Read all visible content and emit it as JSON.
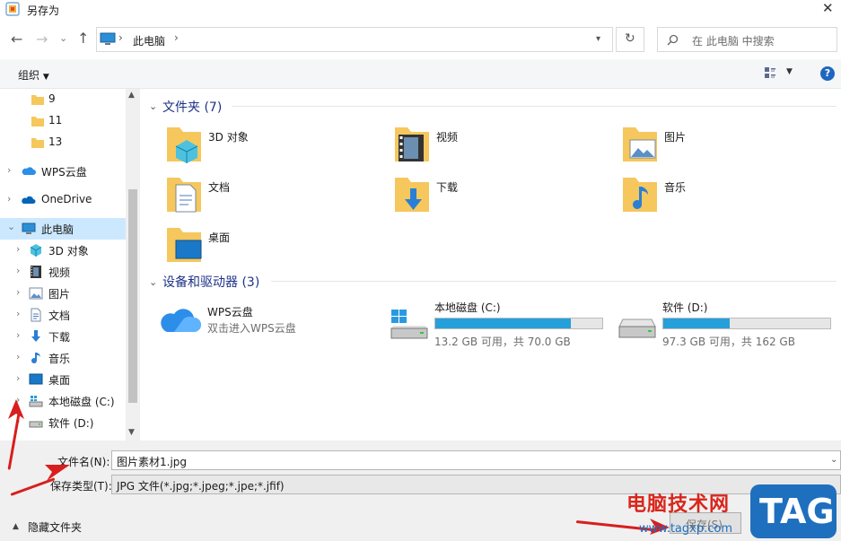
{
  "window": {
    "title": "另存为",
    "close_glyph": "✕"
  },
  "nav": {
    "back_glyph": "←",
    "forward_glyph": "→",
    "recent_glyph": "⌄",
    "up_glyph": "↑",
    "address_label": "此电脑",
    "sep_glyph": "›",
    "refresh_glyph": "↻",
    "search_placeholder": "在 此电脑 中搜索"
  },
  "toolbar": {
    "organize_label": "组织",
    "help_glyph": "?"
  },
  "sidebar": {
    "items": [
      {
        "label": "9"
      },
      {
        "label": "11"
      },
      {
        "label": "13"
      },
      {
        "label": "WPS云盘"
      },
      {
        "label": "OneDrive"
      },
      {
        "label": "此电脑"
      },
      {
        "label": "3D 对象"
      },
      {
        "label": "视频"
      },
      {
        "label": "图片"
      },
      {
        "label": "文档"
      },
      {
        "label": "下载"
      },
      {
        "label": "音乐"
      },
      {
        "label": "桌面"
      },
      {
        "label": "本地磁盘 (C:)"
      },
      {
        "label": "软件 (D:)"
      }
    ]
  },
  "main": {
    "folders_title": "文件夹 (7)",
    "folders": [
      {
        "label": "3D 对象"
      },
      {
        "label": "视频"
      },
      {
        "label": "图片"
      },
      {
        "label": "文档"
      },
      {
        "label": "下载"
      },
      {
        "label": "音乐"
      },
      {
        "label": "桌面"
      }
    ],
    "devices_title": "设备和驱动器 (3)",
    "wps": {
      "name": "WPS云盘",
      "desc": "双击进入WPS云盘"
    },
    "drives": [
      {
        "name": "本地磁盘 (C:)",
        "free": "13.2 GB 可用，共 70.0 GB",
        "used_fraction": 0.81
      },
      {
        "name": "软件 (D:)",
        "free": "97.3 GB 可用，共 162 GB",
        "used_fraction": 0.4
      }
    ]
  },
  "form": {
    "filename_label": "文件名(N):",
    "filename_value": "图片素材1.jpg",
    "filetype_label": "保存类型(T):",
    "filetype_value": "JPG 文件(*.jpg;*.jpeg;*.jpe;*.jfif)",
    "hide_folders_label": "隐藏文件夹",
    "save_label": "保存(S)"
  },
  "watermark": {
    "site_name": "电脑技术网",
    "url": "www.tagxp.com",
    "badge": "TAG"
  },
  "colors": {
    "accent": "#26a0da",
    "selected": "#cce8ff",
    "annotation": "#d81e1e",
    "watermark_blue": "#1f6fbf",
    "watermark_red": "#d9261c"
  }
}
